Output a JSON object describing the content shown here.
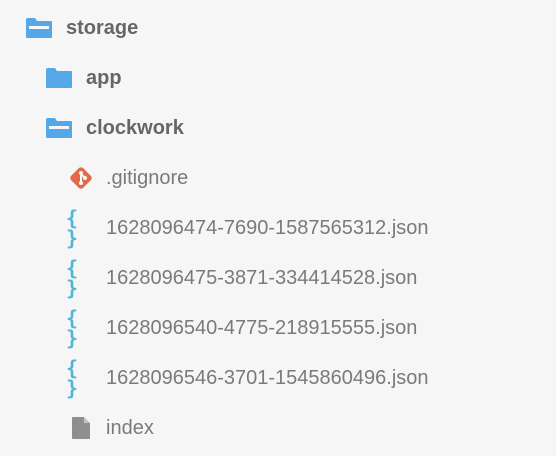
{
  "tree": {
    "root": {
      "label": "storage",
      "icon": "folder-open-icon"
    },
    "children": [
      {
        "label": "app",
        "icon": "folder-closed-icon"
      },
      {
        "label": "clockwork",
        "icon": "folder-open-icon"
      }
    ],
    "clockwork_files": [
      {
        "label": ".gitignore",
        "icon": "git-icon"
      },
      {
        "label": "1628096474-7690-1587565312.json",
        "icon": "json-braces-icon"
      },
      {
        "label": "1628096475-3871-334414528.json",
        "icon": "json-braces-icon"
      },
      {
        "label": "1628096540-4775-218915555.json",
        "icon": "json-braces-icon"
      },
      {
        "label": "1628096546-3701-1545860496.json",
        "icon": "json-braces-icon"
      },
      {
        "label": "index",
        "icon": "file-icon"
      }
    ],
    "json_icon_glyph": "{ }"
  },
  "colors": {
    "background": "#f6f6f6",
    "folder": "#54a8e8",
    "git": "#e26a4c",
    "json": "#4fb7d6",
    "file": "#8f8f8f",
    "text": "#6f6f6f"
  }
}
